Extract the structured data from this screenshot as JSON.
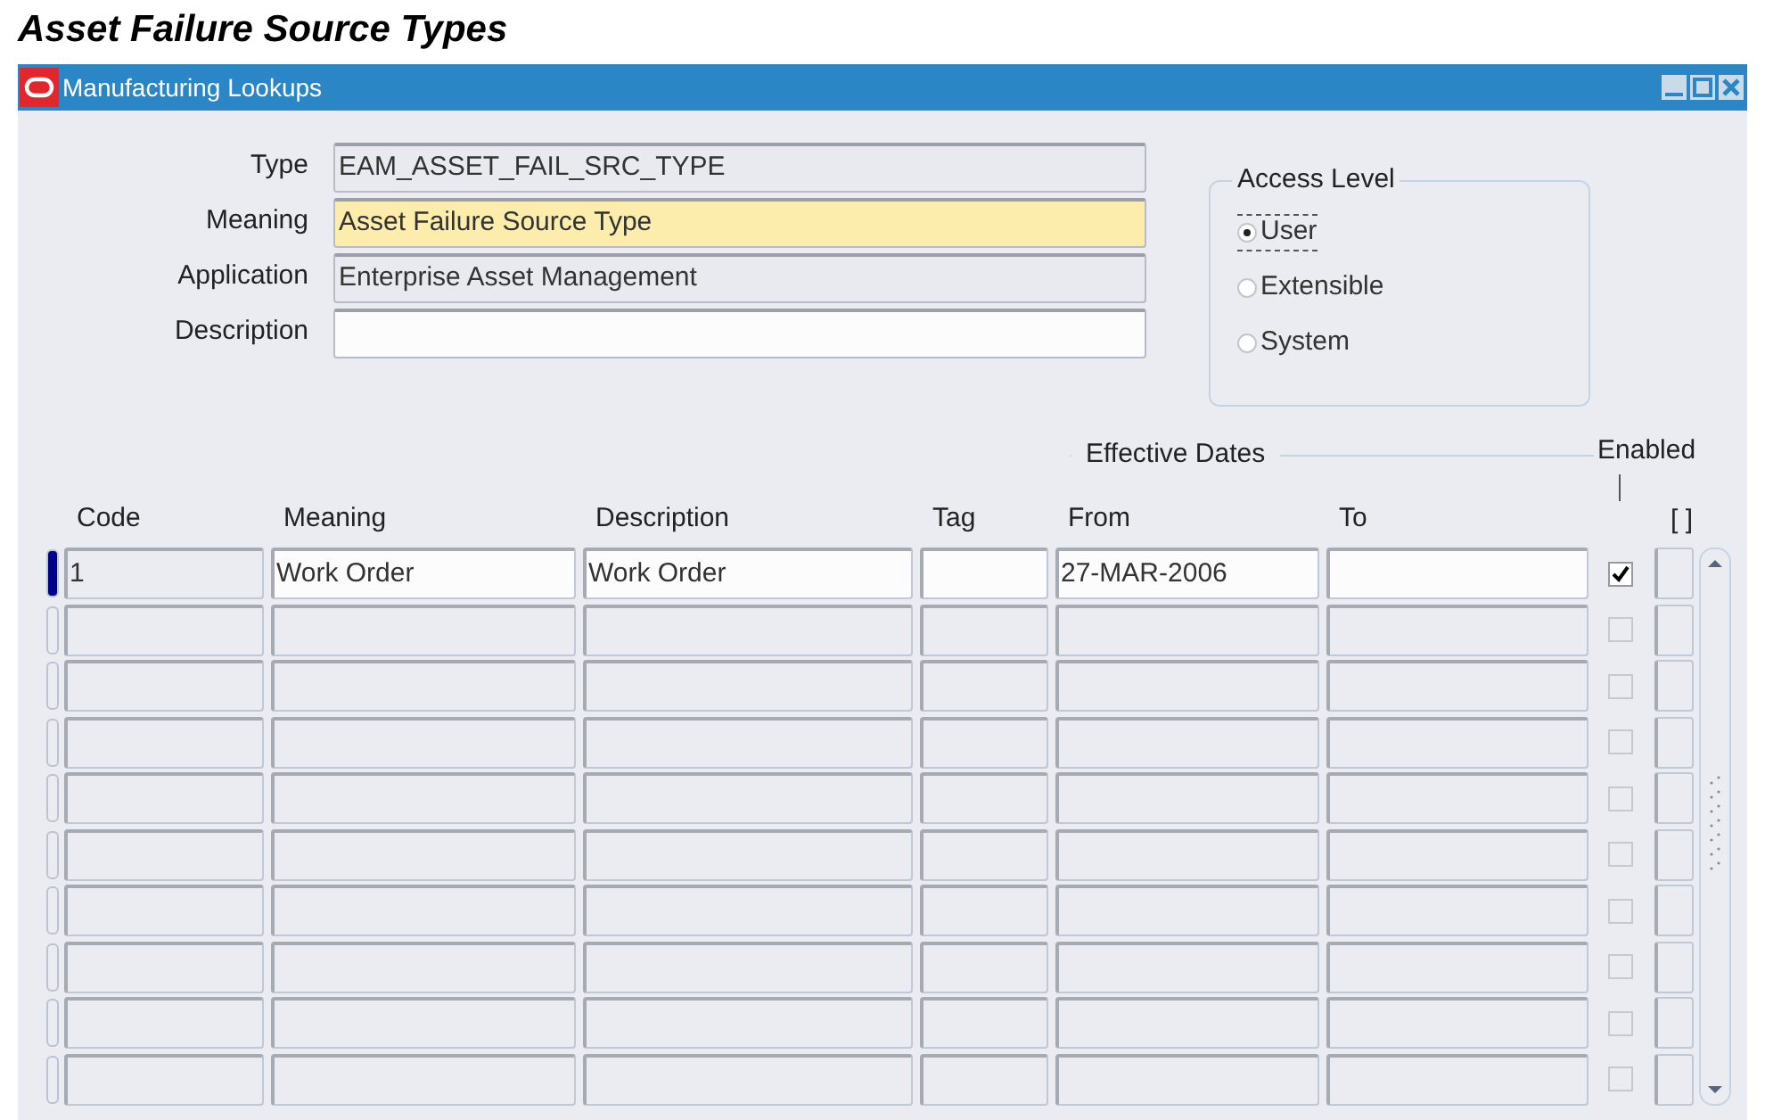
{
  "page_title": "Asset Failure Source Types",
  "window": {
    "title": "Manufacturing Lookups"
  },
  "header_fields": [
    {
      "label": "Type",
      "value": "EAM_ASSET_FAIL_SRC_TYPE",
      "kind": "readonly"
    },
    {
      "label": "Meaning",
      "value": "Asset Failure Source Type",
      "kind": "required"
    },
    {
      "label": "Application",
      "value": "Enterprise Asset Management",
      "kind": "readonly"
    },
    {
      "label": "Description",
      "kind": "optional"
    }
  ],
  "access_level": {
    "title": "Access Level",
    "options": [
      {
        "label": "User",
        "selected": true
      },
      {
        "label": "Extensible",
        "selected": false
      },
      {
        "label": "System",
        "selected": false
      }
    ]
  },
  "table": {
    "group_label": "Effective Dates",
    "enabled_label": "Enabled",
    "flex_label": "[ ]",
    "columns": [
      "Code",
      "Meaning",
      "Description",
      "Tag",
      "From",
      "To"
    ],
    "rows": [
      {
        "selected": true,
        "enabled": true,
        "cells": [
          "1",
          "Work Order",
          "Work Order",
          "",
          "27-MAR-2006",
          ""
        ]
      },
      {
        "selected": false,
        "enabled": false
      },
      {
        "selected": false,
        "enabled": false
      },
      {
        "selected": false,
        "enabled": false
      },
      {
        "selected": false,
        "enabled": false
      },
      {
        "selected": false,
        "enabled": false
      },
      {
        "selected": false,
        "enabled": false
      },
      {
        "selected": false,
        "enabled": false
      },
      {
        "selected": false,
        "enabled": false
      },
      {
        "selected": false,
        "enabled": false
      }
    ]
  }
}
